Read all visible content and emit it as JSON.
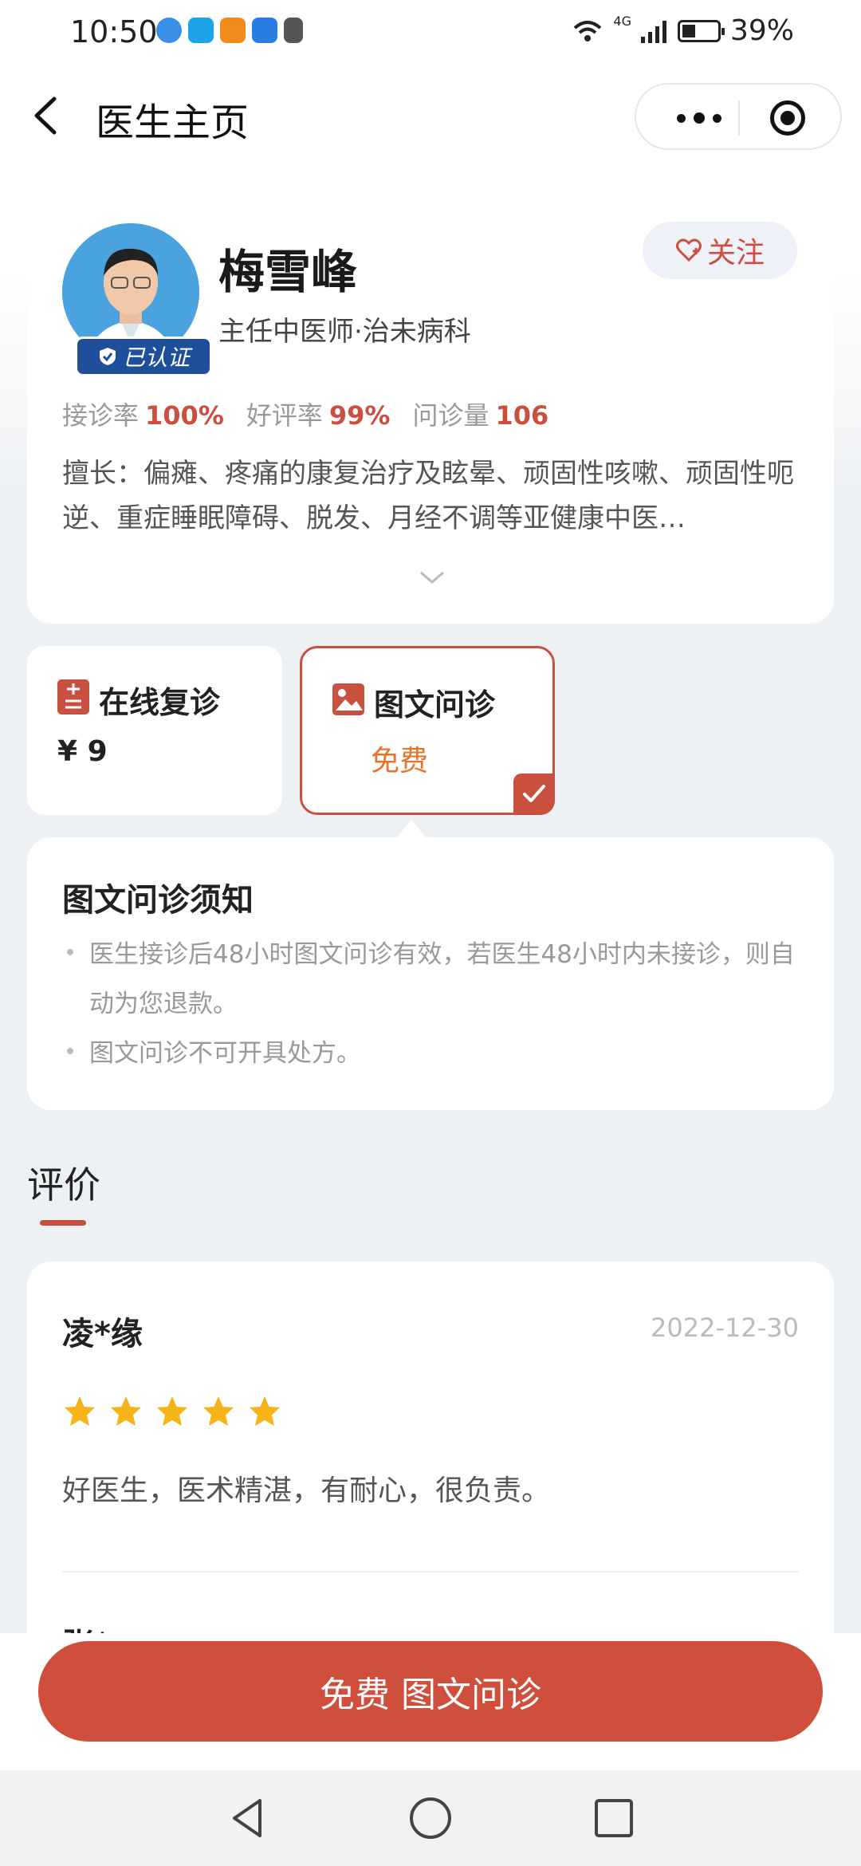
{
  "status_bar": {
    "time": "10:50",
    "network": "4G",
    "battery": "39%"
  },
  "nav": {
    "title": "医生主页"
  },
  "doctor": {
    "name": "梅雪峰",
    "title": "主任中医师·治未病科",
    "verified_label": "已认证",
    "follow_label": "关注",
    "stats": [
      {
        "label": "接诊率",
        "value": "100%"
      },
      {
        "label": "好评率",
        "value": "99%"
      },
      {
        "label": "问诊量",
        "value": "106"
      }
    ],
    "specialty": "擅长：偏瘫、疼痛的康复治疗及眩晕、顽固性咳嗽、顽固性呃逆、重症睡眠障碍、脱发、月经不调等亚健康中医…"
  },
  "services": [
    {
      "label": "在线复诊",
      "price": "¥ 9",
      "icon": "list-doc-icon",
      "selected": false
    },
    {
      "label": "图文问诊",
      "price": "免费",
      "icon": "image-icon",
      "selected": true
    }
  ],
  "notice": {
    "title": "图文问诊须知",
    "items": [
      "医生接诊后48小时图文问诊有效，若医生48小时内未接诊，则自动为您退款。",
      "图文问诊不可开具处方。"
    ]
  },
  "reviews": {
    "heading": "评价",
    "items": [
      {
        "name": "凌*缘",
        "date": "2022-12-30",
        "rating": 5,
        "text": "好医生，医术精湛，有耐心，很负责。"
      },
      {
        "name": "张*"
      }
    ]
  },
  "cta": {
    "label": "免费 图文问诊"
  },
  "colors": {
    "accent": "#cf4e3c",
    "highlight_price": "#e8712c",
    "star": "#f7b418",
    "badge": "#1f4f9a"
  }
}
